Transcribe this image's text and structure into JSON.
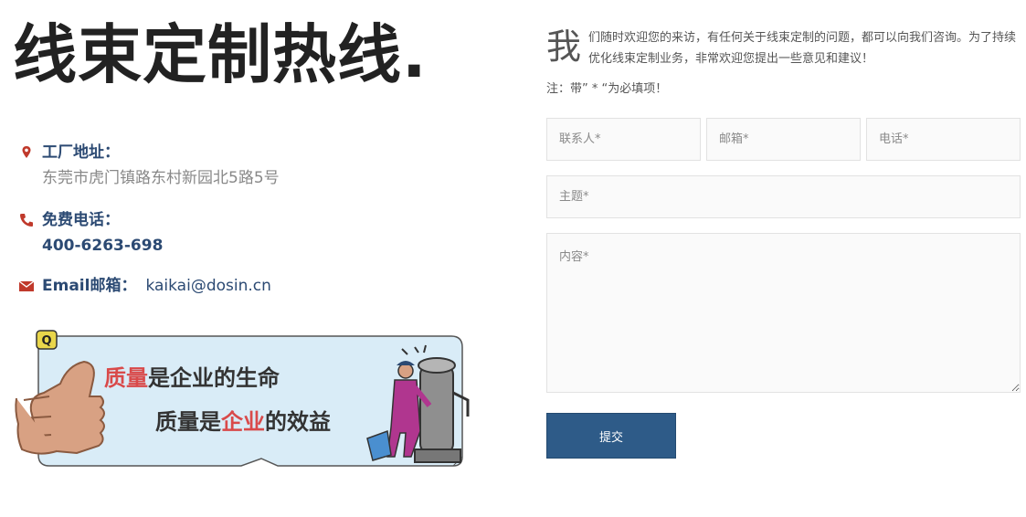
{
  "left": {
    "title": "线束定制热线.",
    "address": {
      "icon": "map-pin-icon",
      "label": "工厂地址：",
      "value": "东莞市虎门镇路东村新园北5路5号"
    },
    "phone": {
      "icon": "phone-icon",
      "label": "免费电话：",
      "value": "400-6263-698"
    },
    "email": {
      "icon": "envelope-icon",
      "label": "Email邮箱：",
      "value": "kaikai@dosin.cn"
    },
    "banner": {
      "line1_highlight": "质量",
      "line1_rest": "是企业的生命",
      "line2_pre": "质量是",
      "line2_highlight": "企业",
      "line2_post": "的效益",
      "badge": "Q"
    }
  },
  "right": {
    "intro_big_char": "我",
    "intro_text": "们随时欢迎您的来访，有任何关于线束定制的问题，都可以向我们咨询。为了持续优化线束定制业务，非常欢迎您提出一些意见和建议！",
    "note": "注：带” * “为必填项！",
    "form": {
      "contact_placeholder": "联系人*",
      "email_placeholder": "邮箱*",
      "phone_placeholder": "电话*",
      "subject_placeholder": "主题*",
      "content_placeholder": "内容*",
      "submit_label": "提交"
    }
  },
  "colors": {
    "accent_blue": "#2c4a73",
    "button_blue": "#2e5b88",
    "icon_red": "#c0392b",
    "highlight_red": "#d94a4a"
  }
}
